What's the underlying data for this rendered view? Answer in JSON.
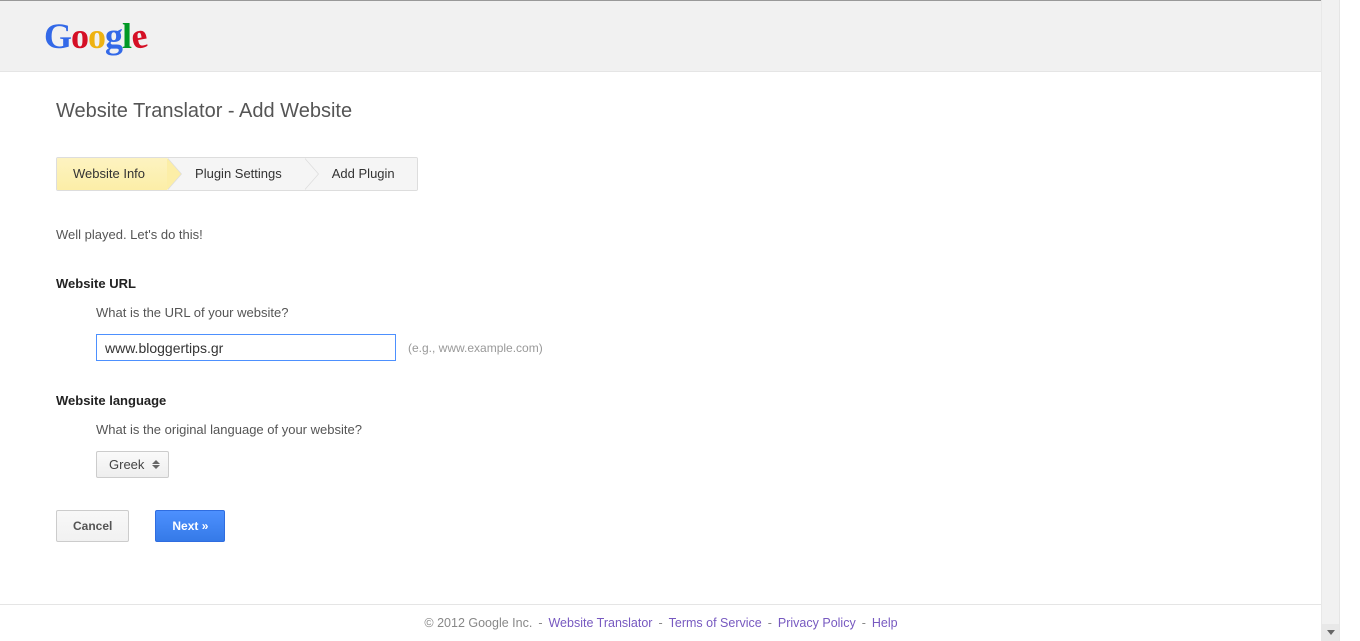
{
  "logo": {
    "letters": [
      "G",
      "o",
      "o",
      "g",
      "l",
      "e"
    ]
  },
  "page_title": "Website Translator - Add Website",
  "steps": [
    {
      "label": "Website Info",
      "active": true
    },
    {
      "label": "Plugin Settings",
      "active": false
    },
    {
      "label": "Add Plugin",
      "active": false
    }
  ],
  "intro_text": "Well played. Let's do this!",
  "url_section": {
    "heading": "Website URL",
    "question": "What is the URL of your website?",
    "value": "www.bloggertips.gr",
    "hint": "(e.g., www.example.com)"
  },
  "lang_section": {
    "heading": "Website language",
    "question": "What is the original language of your website?",
    "selected": "Greek"
  },
  "buttons": {
    "cancel": "Cancel",
    "next": "Next »"
  },
  "footer": {
    "copyright": "© 2012 Google Inc.",
    "links": [
      "Website Translator",
      "Terms of Service",
      "Privacy Policy",
      "Help"
    ]
  }
}
